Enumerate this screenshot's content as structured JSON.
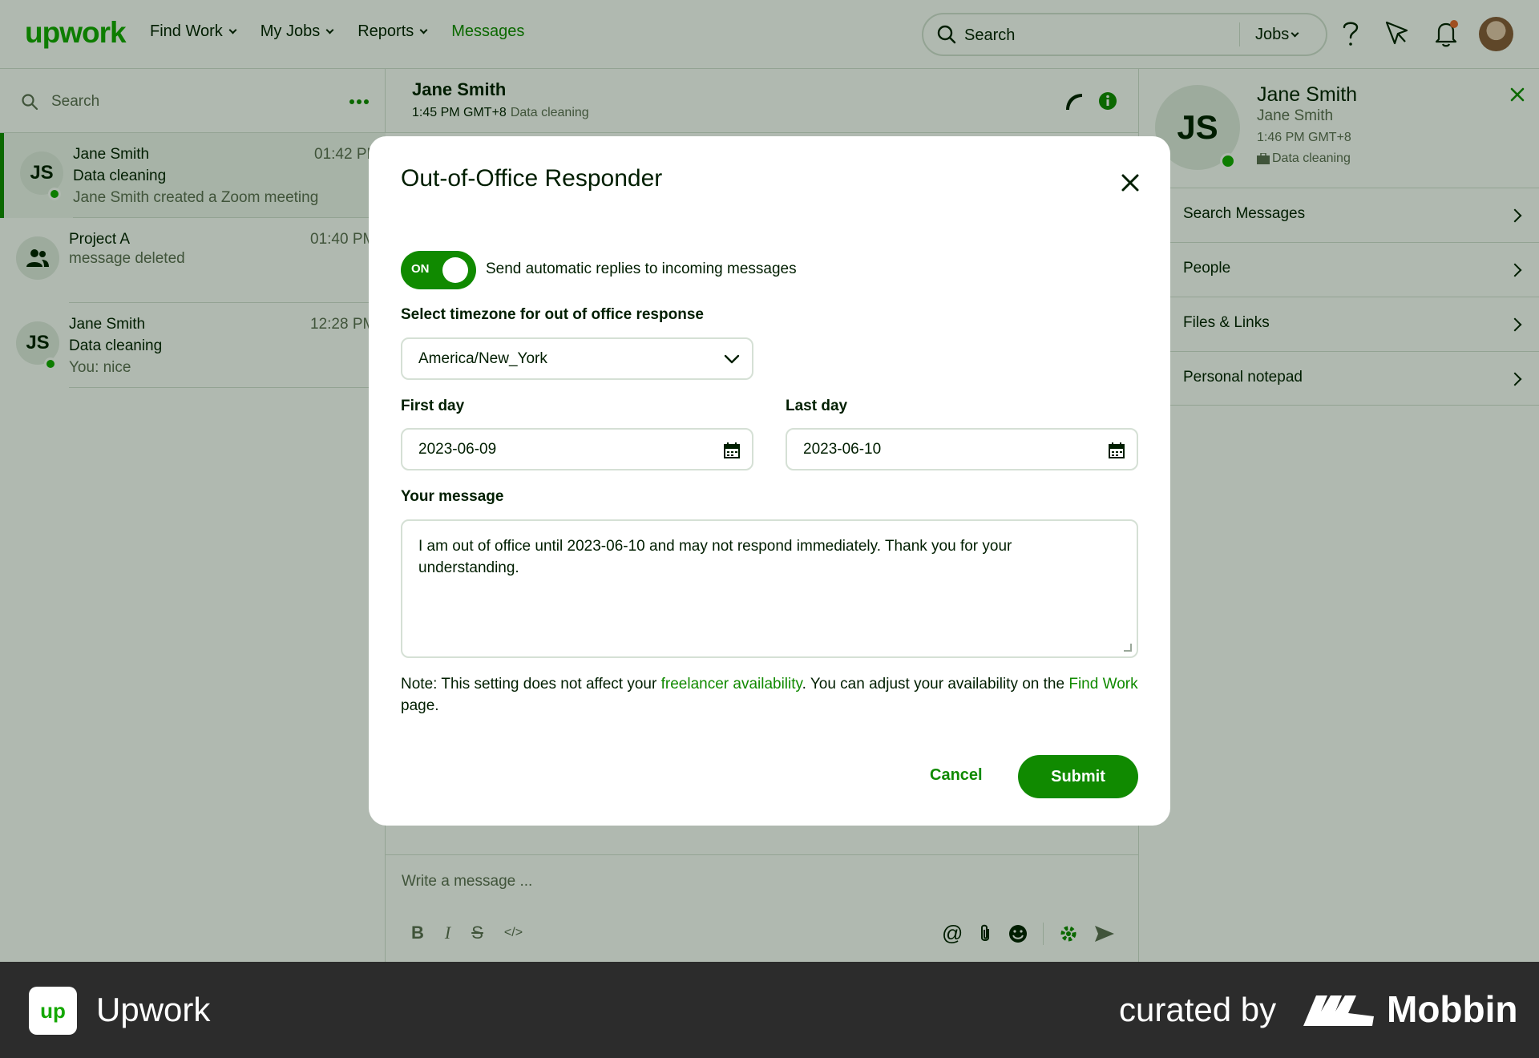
{
  "nav": {
    "logo": "upwork",
    "links": [
      "Find Work",
      "My Jobs",
      "Reports",
      "Messages"
    ],
    "search_placeholder": "Search",
    "search_scope": "Jobs"
  },
  "sidebar": {
    "search_placeholder": "Search",
    "conversations": [
      {
        "initials": "JS",
        "name": "Jane Smith",
        "subtitle": "Data cleaning",
        "preview": "Jane Smith created a Zoom meeting",
        "time": "01:42 PM"
      },
      {
        "initials": "",
        "name": "Project A",
        "subtitle": "message deleted",
        "preview": "",
        "time": "01:40 PM"
      },
      {
        "initials": "JS",
        "name": "Jane Smith",
        "subtitle": "Data cleaning",
        "preview": "You: nice",
        "time": "12:28 PM"
      }
    ]
  },
  "chat": {
    "name": "Jane Smith",
    "time": "1:45 PM GMT+8",
    "job": "Data cleaning",
    "composer_placeholder": "Write a message ..."
  },
  "profile": {
    "initials": "JS",
    "name": "Jane Smith",
    "subname": "Jane Smith",
    "time": "1:46 PM GMT+8",
    "job": "Data cleaning",
    "menu": [
      "Search Messages",
      "People",
      "Files & Links",
      "Personal notepad"
    ]
  },
  "modal": {
    "title": "Out-of-Office Responder",
    "toggle_state": "ON",
    "toggle_label": "Send automatic replies to incoming messages",
    "timezone_label": "Select timezone for out of office response",
    "timezone_value": "America/New_York",
    "first_day_label": "First day",
    "first_day_value": "2023-06-09",
    "last_day_label": "Last day",
    "last_day_value": "2023-06-10",
    "message_label": "Your message",
    "message_value": "I am out of office until 2023-06-10 and may not respond immediately. Thank you for your understanding.",
    "note_prefix": "Note: This setting does not affect your ",
    "note_link1": "freelancer availability",
    "note_middle": ". You can adjust your availability on the ",
    "note_link2": "Find Work",
    "note_suffix": " page.",
    "cancel_label": "Cancel",
    "submit_label": "Submit"
  },
  "footer": {
    "brand_icon": "up",
    "brand": "Upwork",
    "curated": "curated by",
    "mobbin": "Mobbin"
  },
  "colors": {
    "brand_green": "#108a00",
    "upwork_green": "#14a800",
    "border": "#d5e0d5",
    "footer_bg": "#2c2c2c"
  }
}
